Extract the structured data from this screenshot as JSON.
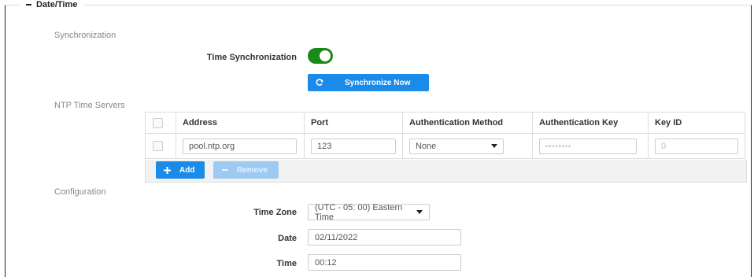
{
  "panel": {
    "title": "Date/Time",
    "collapse_symbol": "−"
  },
  "synchronization": {
    "section_label": "Synchronization",
    "time_sync_label": "Time Synchronization",
    "time_sync_enabled": true,
    "sync_now_label": "Synchronize Now"
  },
  "ntp": {
    "section_label": "NTP Time Servers",
    "columns": [
      "Address",
      "Port",
      "Authentication Method",
      "Authentication Key",
      "Key ID"
    ],
    "rows": [
      {
        "address": "pool.ntp.org",
        "port": "123",
        "auth_method": "None",
        "auth_key": "••••••••",
        "key_id": "0"
      }
    ],
    "add_label": "Add",
    "remove_label": "Remove"
  },
  "configuration": {
    "section_label": "Configuration",
    "time_zone_label": "Time Zone",
    "time_zone_value": "(UTC - 05: 00) Eastern Time",
    "date_label": "Date",
    "date_value": "02/11/2022",
    "time_label": "Time",
    "time_value": "00:12"
  },
  "colors": {
    "toggle_on": "#1a8a1a",
    "primary": "#1a8be8",
    "disabled": "#9ccaf2"
  }
}
